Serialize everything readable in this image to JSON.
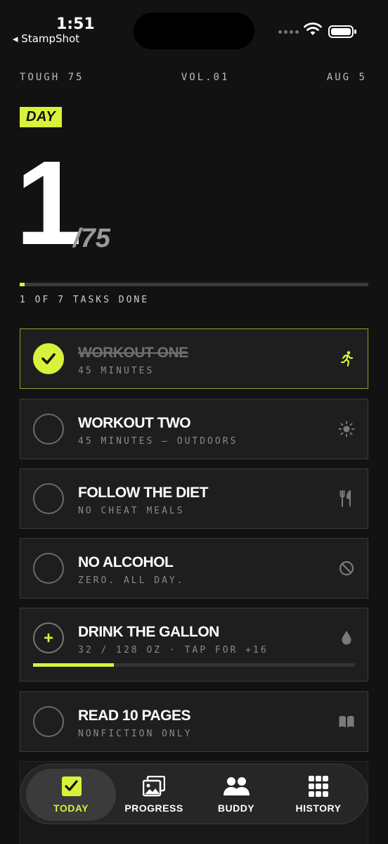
{
  "status": {
    "time": "1:51",
    "back_app": "◂ StampShot"
  },
  "meta": {
    "program": "TOUGH 75",
    "volume": "VOL.01",
    "date": "AUG 5"
  },
  "day": {
    "badge": "DAY",
    "number": "1",
    "total": "/75",
    "progress_fraction": 0.0133
  },
  "tasks_done": "1 OF 7 TASKS DONE",
  "tasks": [
    {
      "title": "WORKOUT ONE",
      "subtitle": "45 MINUTES",
      "done": true,
      "icon": "running-icon"
    },
    {
      "title": "WORKOUT TWO",
      "subtitle": "45 MINUTES — OUTDOORS",
      "done": false,
      "icon": "sun-icon"
    },
    {
      "title": "FOLLOW THE DIET",
      "subtitle": "NO CHEAT MEALS",
      "done": false,
      "icon": "fork-knife-icon"
    },
    {
      "title": "NO ALCOHOL",
      "subtitle": "ZERO. ALL DAY.",
      "done": false,
      "icon": "prohibited-icon"
    },
    {
      "title": "DRINK THE GALLON",
      "subtitle": "32 / 128 OZ · TAP FOR +16",
      "done": false,
      "icon": "water-drop-icon",
      "progress_fraction": 0.25
    },
    {
      "title": "READ 10 PAGES",
      "subtitle": "NONFICTION ONLY",
      "done": false,
      "icon": "book-icon"
    }
  ],
  "tabs": [
    {
      "label": "TODAY",
      "icon": "checkbox-icon",
      "active": true
    },
    {
      "label": "PROGRESS",
      "icon": "photos-icon",
      "active": false
    },
    {
      "label": "BUDDY",
      "icon": "people-icon",
      "active": false
    },
    {
      "label": "HISTORY",
      "icon": "grid-icon",
      "active": false
    }
  ],
  "colors": {
    "accent": "#d8f23a",
    "background": "#121212",
    "card": "#1e1e1e"
  }
}
